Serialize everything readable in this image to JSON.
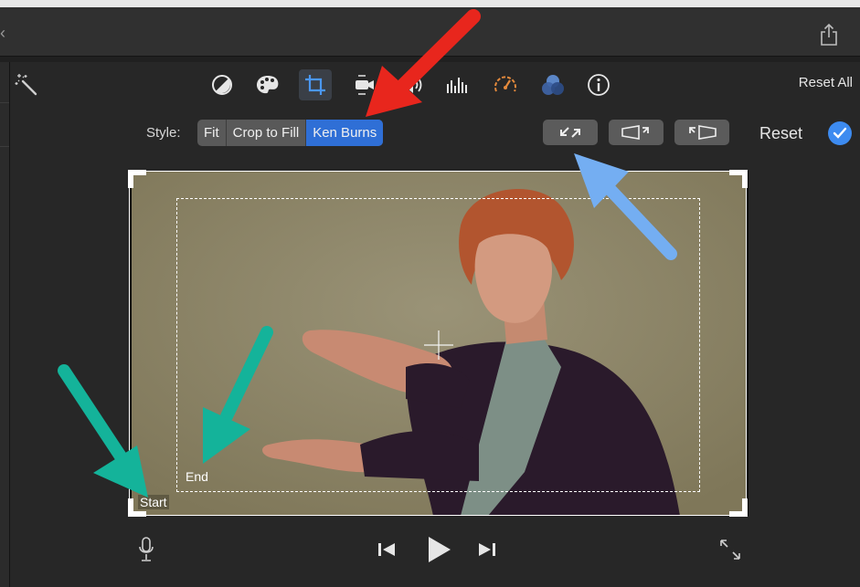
{
  "toolbar": {
    "tools": [
      {
        "name": "color-balance-icon"
      },
      {
        "name": "color-correction-icon"
      },
      {
        "name": "cropping-icon"
      },
      {
        "name": "stabilization-icon"
      },
      {
        "name": "volume-icon"
      },
      {
        "name": "noise-reduction-equalizer-icon"
      },
      {
        "name": "speed-icon"
      },
      {
        "name": "clip-filter-icon"
      },
      {
        "name": "info-icon"
      }
    ],
    "reset_all": "Reset All"
  },
  "style_row": {
    "label": "Style:",
    "options": [
      "Fit",
      "Crop to Fill",
      "Ken Burns"
    ],
    "selected": "Ken Burns",
    "reset": "Reset"
  },
  "viewer": {
    "start_label": "Start",
    "end_label": "End"
  },
  "colors": {
    "accent": "#2f6fd6",
    "check": "#3d8bf0",
    "annotation_red": "#e8261d",
    "annotation_blue": "#74aef2",
    "annotation_teal": "#14b39a"
  }
}
